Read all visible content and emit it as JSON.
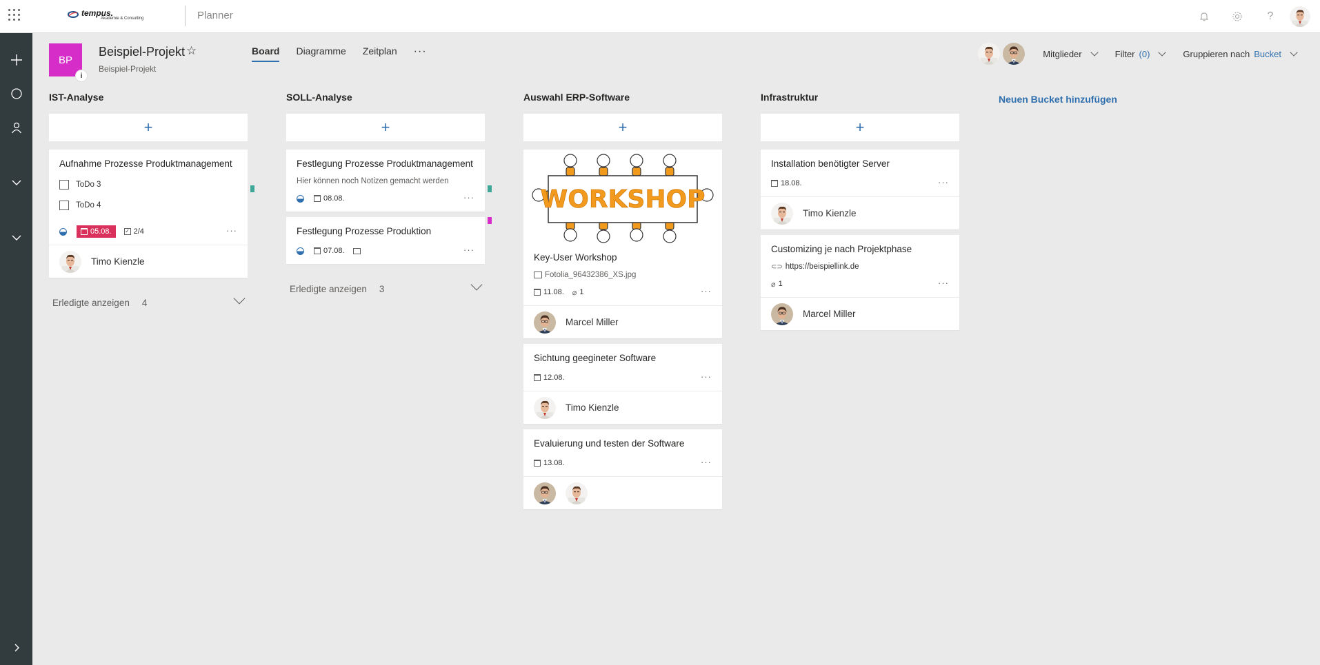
{
  "topbar": {
    "brand": "tempus.",
    "brand_sub": "Akademie & Consulting",
    "app_title": "Planner"
  },
  "header": {
    "project_initials": "BP",
    "project_info": "i",
    "project_name": "Beispiel-Projekt",
    "project_group": "Beispiel-Projekt",
    "tabs": [
      {
        "label": "Board",
        "active": true
      },
      {
        "label": "Diagramme",
        "active": false
      },
      {
        "label": "Zeitplan",
        "active": false
      }
    ],
    "more_tabs": "···",
    "members_label": "Mitglieder",
    "filter_label": "Filter",
    "filter_count": "(0)",
    "group_label": "Gruppieren nach",
    "group_value": "Bucket"
  },
  "colors": {
    "accent": "#2f6fae",
    "project_tile": "#d62dc9",
    "rail": "#323b3e",
    "overdue": "#d9305c",
    "label_teal": "#3fa898",
    "label_magenta": "#d62dc9"
  },
  "new_bucket_label": "Neuen Bucket hinzufügen",
  "buckets": [
    {
      "title": "IST-Analyse",
      "add": "+",
      "cards": [
        {
          "title": "Aufnahme Prozesse Produktmanagement",
          "checklist": [
            "ToDo 3",
            "ToDo 4"
          ],
          "date": "05.08.",
          "checklist_progress": "2/4",
          "more": "···",
          "assignee": "Timo Kienzle"
        }
      ],
      "completed_label": "Erledigte anzeigen",
      "completed_count": "4"
    },
    {
      "title": "SOLL-Analyse",
      "add": "+",
      "cards": [
        {
          "title": "Festlegung Prozesse Produktmanagement",
          "note": "Hier können noch Notizen gemacht werden",
          "date": "08.08.",
          "more": "···"
        },
        {
          "title": "Festlegung Prozesse Produktion",
          "date": "07.08.",
          "more": "···"
        }
      ],
      "completed_label": "Erledigte anzeigen",
      "completed_count": "3"
    },
    {
      "title": "Auswahl ERP-Software",
      "add": "+",
      "cards": [
        {
          "image_text": "WORKSHOP",
          "title": "Key-User Workshop",
          "file": "Fotolia_96432386_XS.jpg",
          "date": "11.08.",
          "attachments": "1",
          "more": "···",
          "assignee": "Marcel Miller"
        },
        {
          "title": "Sichtung geegineter Software",
          "date": "12.08.",
          "more": "···",
          "assignee": "Timo Kienzle"
        },
        {
          "title": "Evaluierung und testen der Software",
          "date": "13.08.",
          "more": "···"
        }
      ]
    },
    {
      "title": "Infrastruktur",
      "add": "+",
      "cards": [
        {
          "title": "Installation benötigter Server",
          "date": "18.08.",
          "more": "···",
          "assignee": "Timo Kienzle"
        },
        {
          "title": "Customizing je nach Projektphase",
          "link": "https://beispiellink.de",
          "attachments": "1",
          "more": "···",
          "assignee": "Marcel Miller"
        }
      ]
    }
  ]
}
